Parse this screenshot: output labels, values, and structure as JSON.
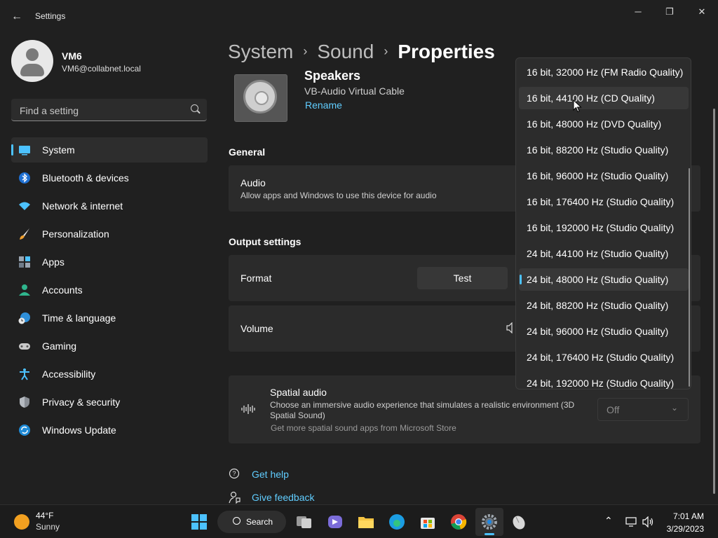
{
  "window": {
    "title": "Settings",
    "minimize": "─",
    "maximize": "❐",
    "close": "✕"
  },
  "user": {
    "name": "VM6",
    "email": "VM6@collabnet.local"
  },
  "search": {
    "placeholder": "Find a setting"
  },
  "nav": {
    "items": [
      {
        "label": "System",
        "icon": "system-icon",
        "selected": true
      },
      {
        "label": "Bluetooth & devices",
        "icon": "bluetooth-icon"
      },
      {
        "label": "Network & internet",
        "icon": "wifi-icon"
      },
      {
        "label": "Personalization",
        "icon": "brush-icon"
      },
      {
        "label": "Apps",
        "icon": "apps-icon"
      },
      {
        "label": "Accounts",
        "icon": "accounts-icon"
      },
      {
        "label": "Time & language",
        "icon": "globe-clock-icon"
      },
      {
        "label": "Gaming",
        "icon": "controller-icon"
      },
      {
        "label": "Accessibility",
        "icon": "accessibility-icon"
      },
      {
        "label": "Privacy & security",
        "icon": "shield-icon"
      },
      {
        "label": "Windows Update",
        "icon": "update-icon"
      }
    ]
  },
  "breadcrumb": {
    "items": [
      "System",
      "Sound",
      "Properties"
    ],
    "separator": "›"
  },
  "device": {
    "name": "Speakers",
    "description": "VB-Audio Virtual Cable",
    "rename": "Rename"
  },
  "general": {
    "heading": "General",
    "audio": {
      "title": "Audio",
      "subtitle": "Allow apps and Windows to use this device for audio"
    }
  },
  "output": {
    "heading": "Output settings",
    "format": {
      "title": "Format",
      "test_button": "Test"
    },
    "volume": {
      "title": "Volume"
    },
    "spatial": {
      "title": "Spatial audio",
      "subtitle_line1": "Choose an immersive audio experience that simulates a realistic environment (3D",
      "subtitle_line2": "Spatial Sound)",
      "store_link": "Get more spatial sound apps from Microsoft Store",
      "value": "Off"
    }
  },
  "help": {
    "get_help": "Get help",
    "feedback": "Give feedback"
  },
  "format_dropdown": {
    "options": [
      "16 bit, 32000 Hz (FM Radio Quality)",
      "16 bit, 44100 Hz (CD Quality)",
      "16 bit, 48000 Hz (DVD Quality)",
      "16 bit, 88200 Hz (Studio Quality)",
      "16 bit, 96000 Hz (Studio Quality)",
      "16 bit, 176400 Hz (Studio Quality)",
      "16 bit, 192000 Hz (Studio Quality)",
      "24 bit, 44100 Hz (Studio Quality)",
      "24 bit, 48000 Hz (Studio Quality)",
      "24 bit, 88200 Hz (Studio Quality)",
      "24 bit, 96000 Hz (Studio Quality)",
      "24 bit, 176400 Hz (Studio Quality)",
      "24 bit, 192000 Hz (Studio Quality)"
    ],
    "selected": "24 bit, 48000 Hz (Studio Quality)",
    "hovered": "16 bit, 44100 Hz (CD Quality)"
  },
  "taskbar": {
    "weather": {
      "temp": "44°F",
      "condition": "Sunny"
    },
    "search_label": "Search",
    "apps": [
      "start-icon",
      "task-view-icon",
      "teams-icon",
      "file-explorer-icon",
      "edge-icon",
      "store-icon",
      "chrome-icon",
      "settings-icon",
      "mouse-app-icon"
    ],
    "time": "7:01 AM",
    "date": "3/29/2023"
  },
  "colors": {
    "accent": "#4cc2ff",
    "link": "#60cdff",
    "background": "#202020",
    "card": "#2b2b2b"
  }
}
